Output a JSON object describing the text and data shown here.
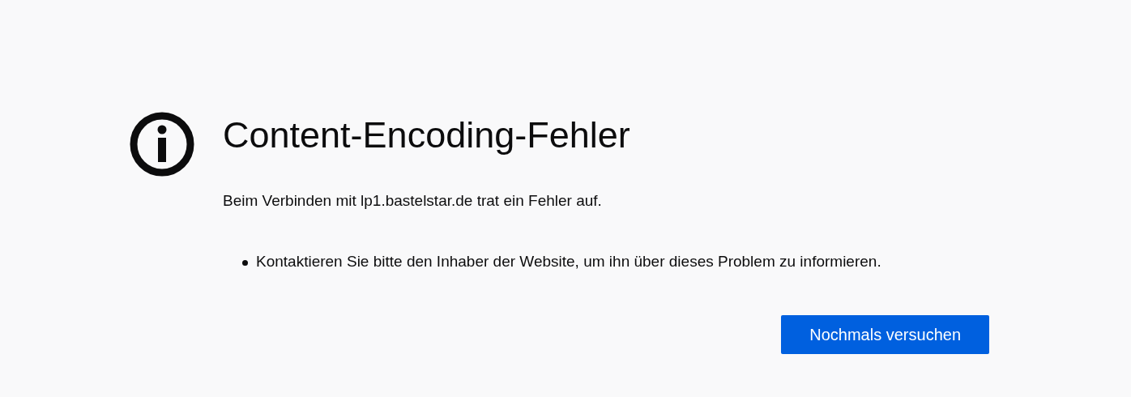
{
  "title": "Content-Encoding-Fehler",
  "message": "Beim Verbinden mit lp1.bastelstar.de trat ein Fehler auf.",
  "suggestions": [
    "Kontaktieren Sie bitte den Inhaber der Website, um ihn über dieses Problem zu informieren."
  ],
  "buttons": [
    "Nochmals versuchen"
  ]
}
